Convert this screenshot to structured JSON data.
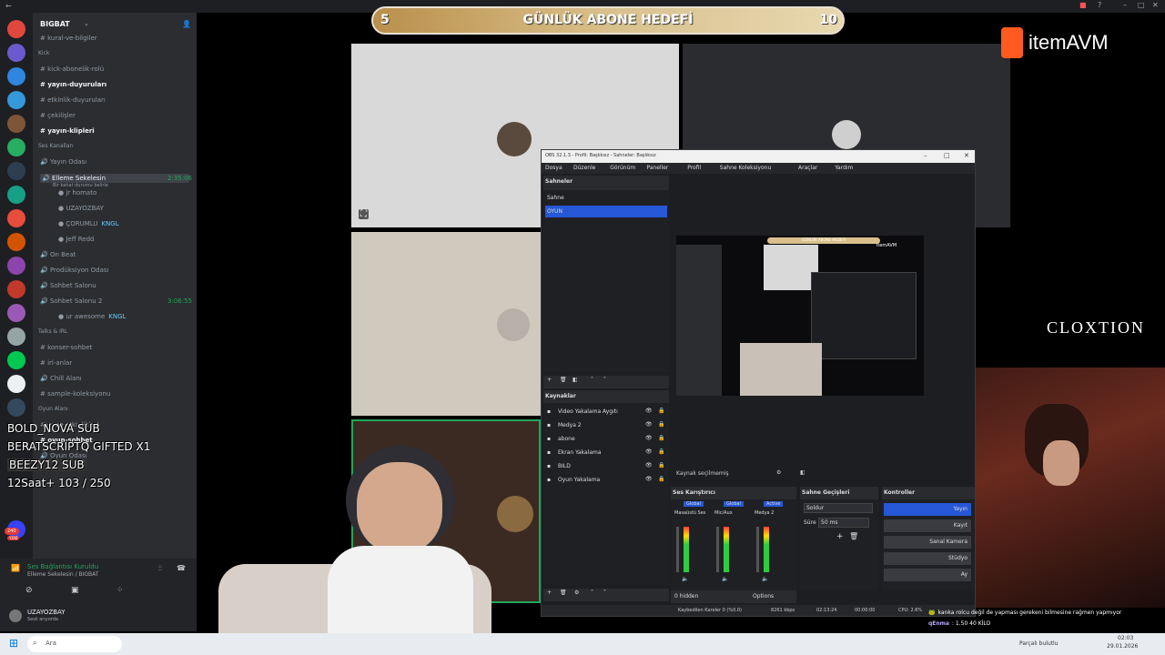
{
  "discord": {
    "server_name": "BIGBAT",
    "channels": [
      {
        "label": "kural-ve-bilgiler",
        "type": "text"
      },
      {
        "label": "Kick",
        "type": "category"
      },
      {
        "label": "kick-abonelik-rolü",
        "type": "text"
      },
      {
        "label": "yayın-duyuruları",
        "type": "text",
        "bold": true
      },
      {
        "label": "etkinlik-duyuruları",
        "type": "text"
      },
      {
        "label": "çekilişler",
        "type": "text"
      },
      {
        "label": "yayın-klipleri",
        "type": "text",
        "bold": true
      },
      {
        "label": "Ses Kanalları",
        "type": "category"
      },
      {
        "label": "Yayın Odası",
        "type": "voice"
      },
      {
        "label": "Elleme Sekelesin",
        "type": "voice",
        "active": true,
        "time": "2:35:06",
        "subtitle": "Bir kahat durumu belirle"
      },
      {
        "label": "jr homato",
        "type": "member"
      },
      {
        "label": "UZAYOZBAY",
        "type": "member"
      },
      {
        "label": "ÇORUMLU",
        "type": "member",
        "tag": "KNGL"
      },
      {
        "label": "Jeff Redd",
        "type": "member"
      },
      {
        "label": "On Beat",
        "type": "voice"
      },
      {
        "label": "Prodüksiyon Odası",
        "type": "voice"
      },
      {
        "label": "Sohbet Salonu",
        "type": "voice"
      },
      {
        "label": "Sohbet Salonu 2",
        "type": "voice",
        "time": "3:06:55"
      },
      {
        "label": "ur awesome",
        "type": "member",
        "tag": "KNGL"
      },
      {
        "label": "Talks & IRL",
        "type": "category"
      },
      {
        "label": "konser-sohbet",
        "type": "text"
      },
      {
        "label": "irl-anlar",
        "type": "text"
      },
      {
        "label": "Chill Alanı",
        "type": "voice"
      },
      {
        "label": "sample-koleksiyonu",
        "type": "text"
      },
      {
        "label": "Oyun Alanı",
        "type": "category"
      },
      {
        "label": "oyun-etkinlikleri",
        "type": "text"
      },
      {
        "label": "oyun-sohbet",
        "type": "text",
        "bold": true
      },
      {
        "label": "Oyun Odası",
        "type": "voice"
      }
    ],
    "voice_status": "Ses Bağlantısı Kuruldu",
    "voice_sub": "Elleme Sekelesin / BIGBAT",
    "user_name": "UZAYOZBAY",
    "user_status": "Sesli arıyorda",
    "badge_count": "240",
    "badge_label": "YENİ"
  },
  "goal": {
    "current": "5",
    "title": "GÜNLÜK ABONE HEDEFİ",
    "target": "10"
  },
  "sponsor": "itemAVM",
  "watermark": "CLOXTION",
  "alerts": [
    {
      "text": "BOLD_NOVA  SUB"
    },
    {
      "text": "BERATSCRIPTQ  GIFTED X1"
    },
    {
      "text": "BEEZY12  SUB"
    },
    {
      "text": "12Saat+  103 / 250"
    }
  ],
  "obs": {
    "title": "OBS 32.1.3 - Profil: Başlıksız - Sahneler: Başlıksız",
    "menu": [
      "Dosya",
      "Düzenle",
      "Görünüm",
      "Paneller",
      "Profil",
      "Sahne Koleksiyonu",
      "Araçlar",
      "Yardım"
    ],
    "scenes_header": "Sahneler",
    "scenes": [
      "Sahne",
      "OYUN"
    ],
    "sources_header": "Kaynaklar",
    "sources": [
      "Video Yakalama Aygıtı",
      "Medya 2",
      "abone",
      "Ekran Yakalama",
      "BILD",
      "Oyun Yakalama"
    ],
    "no_source": "Kaynak seçilmemiş",
    "mixer_header": "Ses Karıştırıcı",
    "mixer_channels": [
      "Masaüstü Ses",
      "Mic/Aux",
      "Medya 2"
    ],
    "mixer_tags": [
      "Global",
      "Global",
      "Active"
    ],
    "transitions_header": "Sahne Geçişleri",
    "transition_value": "Soldur",
    "duration_label": "Süre",
    "duration_value": "50 ms",
    "controls_header": "Kontroller",
    "controls": [
      "Yayın",
      "Kayıt",
      "Sanal Kamera",
      "Stüdyo",
      "Ay"
    ],
    "hidden_label": "0 hidden",
    "options_label": "Options",
    "status_dropped": "Kaybedilen Kareler 0 (%0.0)",
    "status_kbps": "8261 kbps",
    "status_time": "02:13:24",
    "status_rec": "00:00:00",
    "status_cpu": "CPU: 2.6%",
    "preview_goal": "GÜNLÜK ABONE HEDEFİ"
  },
  "chat": [
    {
      "user": "🐸",
      "text": "kanka rolcu değil de yapması gerekeni bilmesine rağmen yapmıyor",
      "color": "#ffffff"
    },
    {
      "user": "qEnma",
      "text": ": 1.50 40 KİLO",
      "color": "#b7a5ff"
    }
  ],
  "taskbar": {
    "search_placeholder": "Ara",
    "clock_time": "02:03",
    "clock_date": "29.01.2026",
    "weather_text": "Parçalı bulutlu"
  }
}
